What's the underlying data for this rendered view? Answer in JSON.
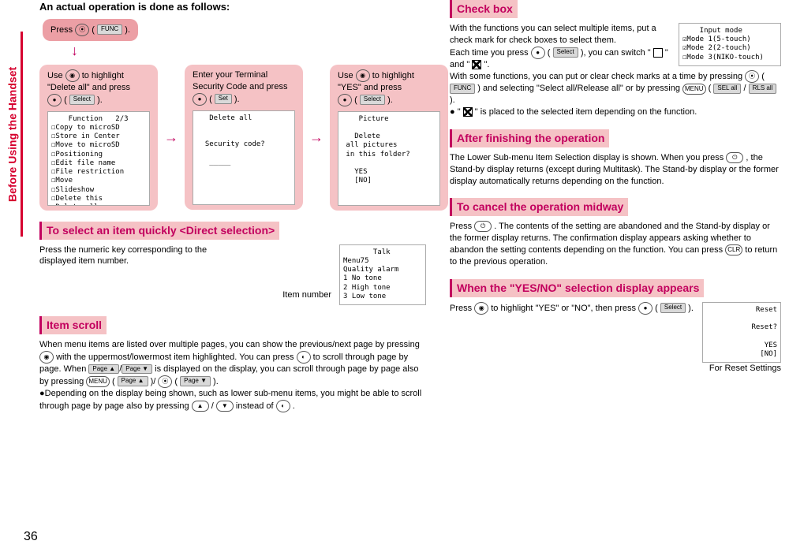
{
  "sidetab": "Before Using the Handset",
  "page_number": "36",
  "col1": {
    "heading": "An actual operation is done as follows:",
    "step0": {
      "text_a": "Press ",
      "text_b": "(",
      "chip": "FUNC",
      "text_c": ")."
    },
    "step1": {
      "line_a": "Use ",
      "line_b": " to highlight",
      "line_c": "\"Delete all\" and press",
      "line_d": "(",
      "chip": "Select",
      "line_e": ").",
      "screen": "    Function   2/3\n☐Copy to microSD\n☐Store in Center\n☐Move to microSD\n☐Positioning\n☐Edit file name\n☐File restriction\n☐Move\n☐Slideshow\n☐Delete this\n■Delete all"
    },
    "step2": {
      "line_a": "Enter your Terminal",
      "line_b": "Security Code and press",
      "line_c": "(",
      "chip": "Set",
      "line_d": ").",
      "screen": "   Delete all\n\n\n  Security code?\n\n   _____"
    },
    "step3": {
      "line_a": "Use ",
      "line_b": " to highlight",
      "line_c": "\"YES\" and press",
      "line_d": "(",
      "chip": "Select",
      "line_e": ").",
      "screen": "    Picture\n\n   Delete\n all pictures\n in this folder?\n\n   YES\n   [NO]"
    },
    "direct_title": "To select an item quickly <Direct selection>",
    "direct_body_a": "Press the numeric key corresponding to the",
    "direct_body_b": "displayed item number.",
    "direct_label": "Item number",
    "direct_screen": "       Talk\nMenu75\nQuality alarm\n1 No tone\n2 High tone\n3 Low tone",
    "scroll_title": "Item scroll",
    "scroll_body": "When menu items are listed over multiple pages, you can show the previous/next page by pressing ",
    "scroll_body2": " with the uppermost/lowermost item highlighted. You can press ",
    "scroll_body3": " to scroll through page by page. When ",
    "page_up": "Page ▲",
    "page_dn": "Page ▼",
    "scroll_body4": " is displayed on the display, you can scroll through page by page also by pressing ",
    "menu_key": "MENU",
    "scroll_body5": "(",
    "scroll_body6": ")/",
    "scroll_body7": "(",
    "scroll_body8a": ").",
    "scroll_body9": "●Depending on the display being shown, such as lower sub-menu items, you might be able to scroll through page by page also by pressing ",
    "scroll_body10": "/",
    "scroll_body11": " instead of ",
    "scroll_body12": "."
  },
  "col2": {
    "cb_title": "Check box",
    "cb_body1": "With the functions you can select multiple items, put a check mark for check boxes to select them.",
    "cb_body2a": "Each time you press ",
    "cb_body2b": "(",
    "cb_chip1": "Select",
    "cb_body2c": "), you can switch \"",
    "cb_body2d": "\" and \"",
    "cb_body2e": "\".",
    "cb_body3a": "With some functions, you can put or clear check marks at a time by pressing ",
    "cb_body3b": "(",
    "cb_chip2": "FUNC",
    "cb_body3c": ") and selecting \"Select all/Release all\" or by pressing ",
    "menu_label": "MENU",
    "sel_all": "SEL all",
    "rls_all": "RLS all",
    "cb_body3d": "(",
    "cb_body3e": "/",
    "cb_body3f": ").",
    "cb_body4": "● \"",
    "cb_body4b": "\" is placed to the selected item depending on the function.",
    "cb_screen": "    Input mode\n☑Mode 1(5-touch)\n☑Mode 2(2-touch)\n☐Mode 3(NIKO-touch)",
    "after_title": "After finishing the operation",
    "after_body": "The Lower Sub-menu Item Selection display is shown. When you press ",
    "after_body2": ", the Stand-by display returns (except during Multitask). The Stand-by display or the former display automatically returns depending on the function.",
    "cancel_title": "To cancel the operation midway",
    "cancel_body": "Press ",
    "cancel_body2": ". The contents of the setting are abandoned and the Stand-by display or the former display returns. The confirmation display appears asking whether to abandon the setting contents depending on the function. You can press ",
    "clr_key": "CLR",
    "cancel_body3": " to return to the previous operation.",
    "yesno_title": "When the \"YES/NO\" selection display appears",
    "yesno_body_a": "Press ",
    "yesno_body_b": " to highlight \"YES\" or \"NO\", then press ",
    "yesno_body_c": "(",
    "yn_chip": "Select",
    "yesno_body_d": ").",
    "yesno_screen": "    Reset\n\n   Reset?\n\n   YES\n   [NO]",
    "yesno_caption": "For Reset Settings"
  }
}
